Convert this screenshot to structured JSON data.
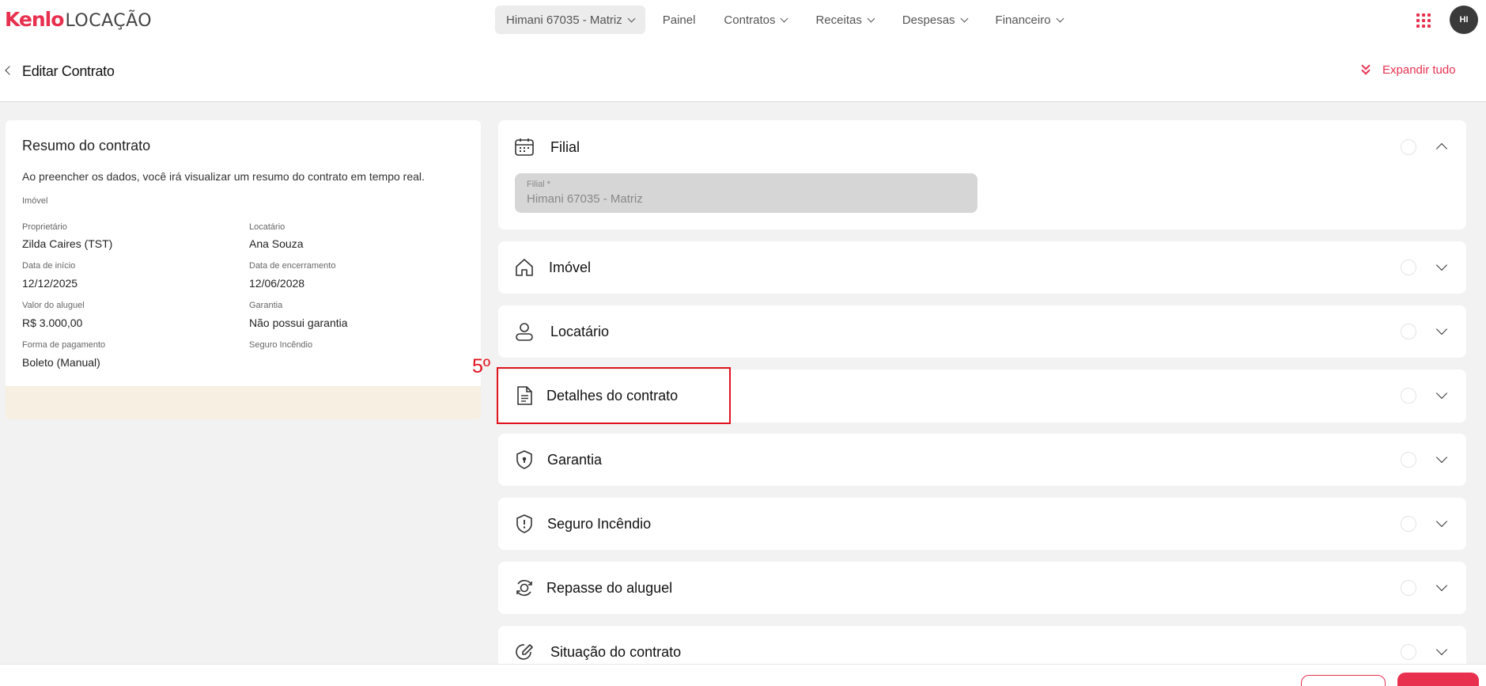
{
  "app": {
    "logo_brand": "Kenlo",
    "logo_product": "LOCAÇÃO",
    "avatar_initials": "HI",
    "accent_color": "#e8304f"
  },
  "nav": {
    "branch": "Himani 67035 - Matriz",
    "items": [
      "Painel",
      "Contratos",
      "Receitas",
      "Despesas",
      "Financeiro"
    ]
  },
  "page": {
    "title": "Editar Contrato",
    "expand_all": "Expandir tudo"
  },
  "summary": {
    "title": "Resumo do contrato",
    "description": "Ao preencher os dados, você irá visualizar um resumo do contrato em tempo real.",
    "property_label": "Imóvel",
    "owner_label": "Proprietário",
    "owner_value": "Zilda Caires (TST)",
    "tenant_label": "Locatário",
    "tenant_value": "Ana Souza",
    "start_label": "Data de início",
    "start_value": "12/12/2025",
    "end_label": "Data de encerramento",
    "end_value": "12/06/2028",
    "rent_label": "Valor do aluguel",
    "rent_value": "R$ 3.000,00",
    "guarantee_label": "Garantia",
    "guarantee_value": "Não possui garantia",
    "payment_label": "Forma de pagamento",
    "payment_value": "Boleto (Manual)",
    "insurance_label": "Seguro Incêndio"
  },
  "sections": {
    "filial": "Filial",
    "filial_field_label": "Filial *",
    "filial_field_value": "Himani 67035 - Matriz",
    "imovel": "Imóvel",
    "locatario": "Locatário",
    "detalhes": "Detalhes do contrato",
    "garantia": "Garantia",
    "seguro": "Seguro Incêndio",
    "repasse": "Repasse do aluguel",
    "situacao": "Situação do contrato"
  },
  "annotation": {
    "step": "5º",
    "color": "#e0131f"
  }
}
